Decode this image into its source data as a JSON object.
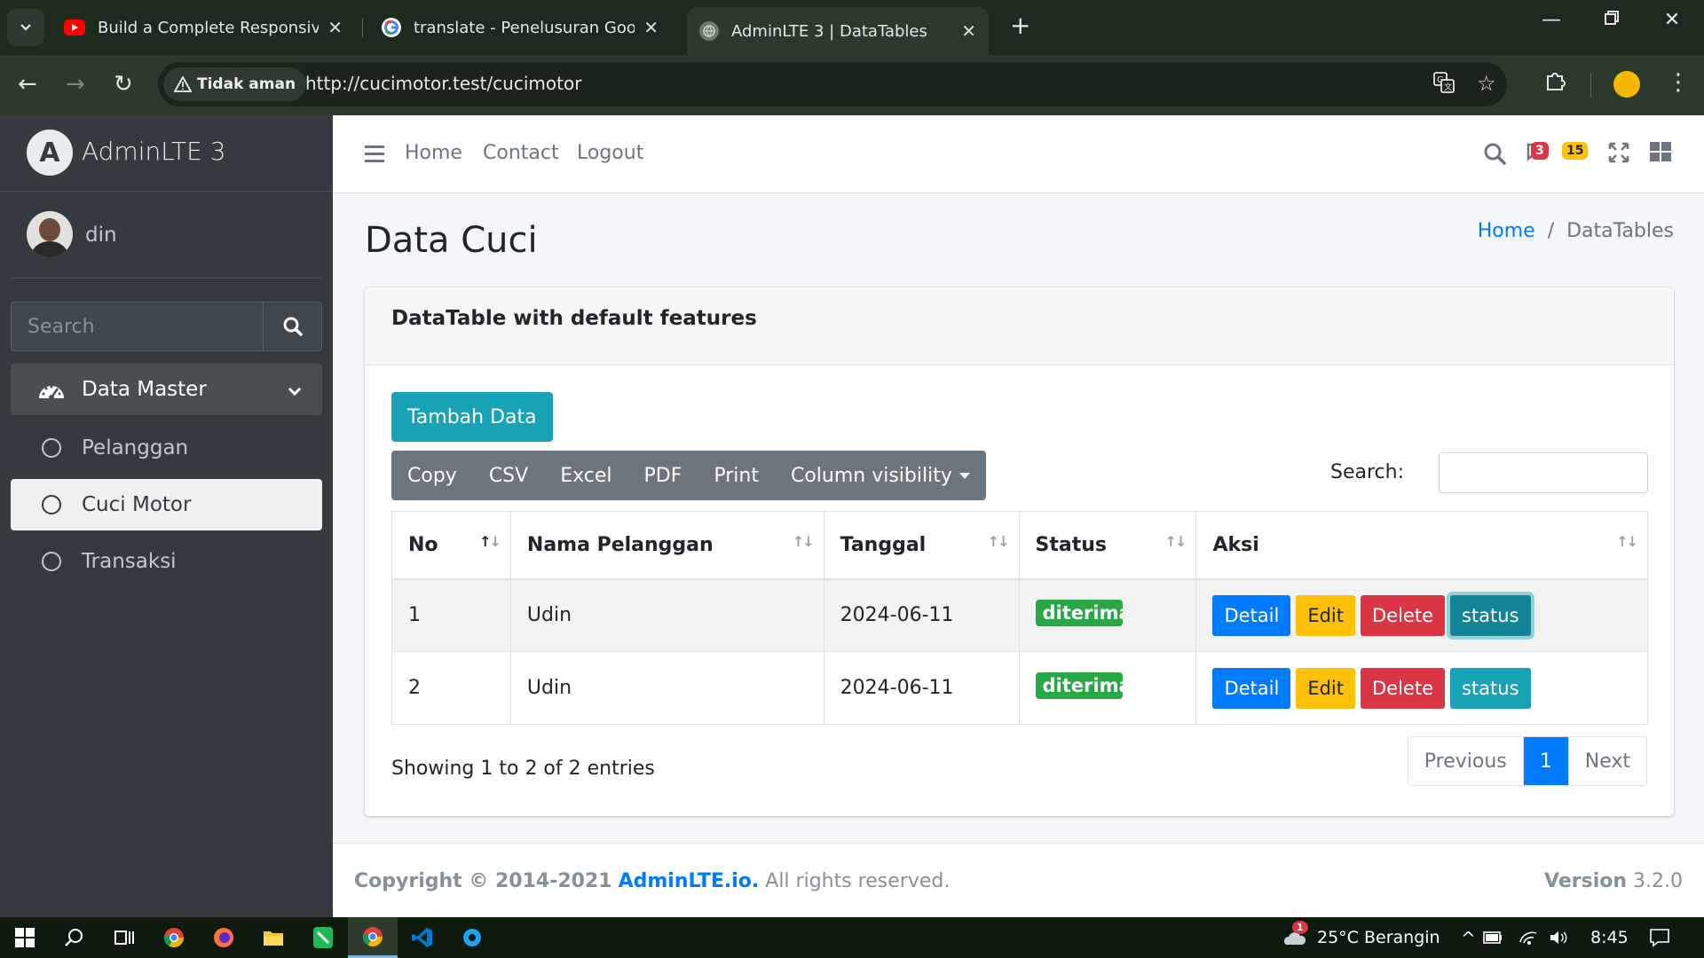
{
  "browser": {
    "tabs": [
      {
        "title": "Build a Complete Responsive Pe",
        "favicon": "youtube-icon"
      },
      {
        "title": "translate - Penelusuran Google",
        "favicon": "google-icon"
      },
      {
        "title": "AdminLTE 3 | DataTables",
        "favicon": "globe-icon"
      }
    ],
    "security_label": "Tidak aman",
    "url": "http://cucimotor.test/cucimotor"
  },
  "sidebar": {
    "brand": "AdminLTE 3",
    "brand_logo_letter": "A",
    "user_name": "din",
    "search_placeholder": "Search",
    "menu": [
      {
        "label": "Data Master",
        "icon": "tachometer-icon"
      },
      {
        "label": "Pelanggan",
        "icon": "circle-icon"
      },
      {
        "label": "Cuci Motor",
        "icon": "circle-icon"
      },
      {
        "label": "Transaksi",
        "icon": "circle-icon"
      }
    ]
  },
  "topnav": {
    "links": [
      "Home",
      "Contact",
      "Logout"
    ],
    "messages_count": "3",
    "notifications_count": "15",
    "colors": {
      "danger": "#dc3545",
      "warning": "#ffc107"
    }
  },
  "content": {
    "title": "Data Cuci",
    "breadcrumb": {
      "home": "Home",
      "current": "DataTables"
    }
  },
  "card": {
    "title": "DataTable with default features",
    "add_button": "Tambah Data",
    "export_buttons": [
      "Copy",
      "CSV",
      "Excel",
      "PDF",
      "Print"
    ],
    "column_visibility": "Column visibility",
    "search_label": "Search:",
    "columns": [
      "No",
      "Nama Pelanggan",
      "Tanggal",
      "Status",
      "Aksi"
    ],
    "rows": [
      {
        "no": "1",
        "nama": "Udin",
        "tanggal": "2024-06-11",
        "status": "diterima"
      },
      {
        "no": "2",
        "nama": "Udin",
        "tanggal": "2024-06-11",
        "status": "diterima"
      }
    ],
    "actions": {
      "detail": "Detail",
      "edit": "Edit",
      "delete": "Delete",
      "status": "status"
    },
    "info": "Showing 1 to 2 of 2 entries",
    "pagination": {
      "previous": "Previous",
      "current": "1",
      "next": "Next"
    }
  },
  "footer": {
    "copyright_prefix": "Copyright © 2014-2021",
    "brand_link": "AdminLTE.io.",
    "rights": "All rights reserved.",
    "version_label": "Version",
    "version_value": "3.2.0"
  },
  "taskbar": {
    "weather": "25°C  Berangin",
    "time": "8:45",
    "weather_badge": "1"
  }
}
